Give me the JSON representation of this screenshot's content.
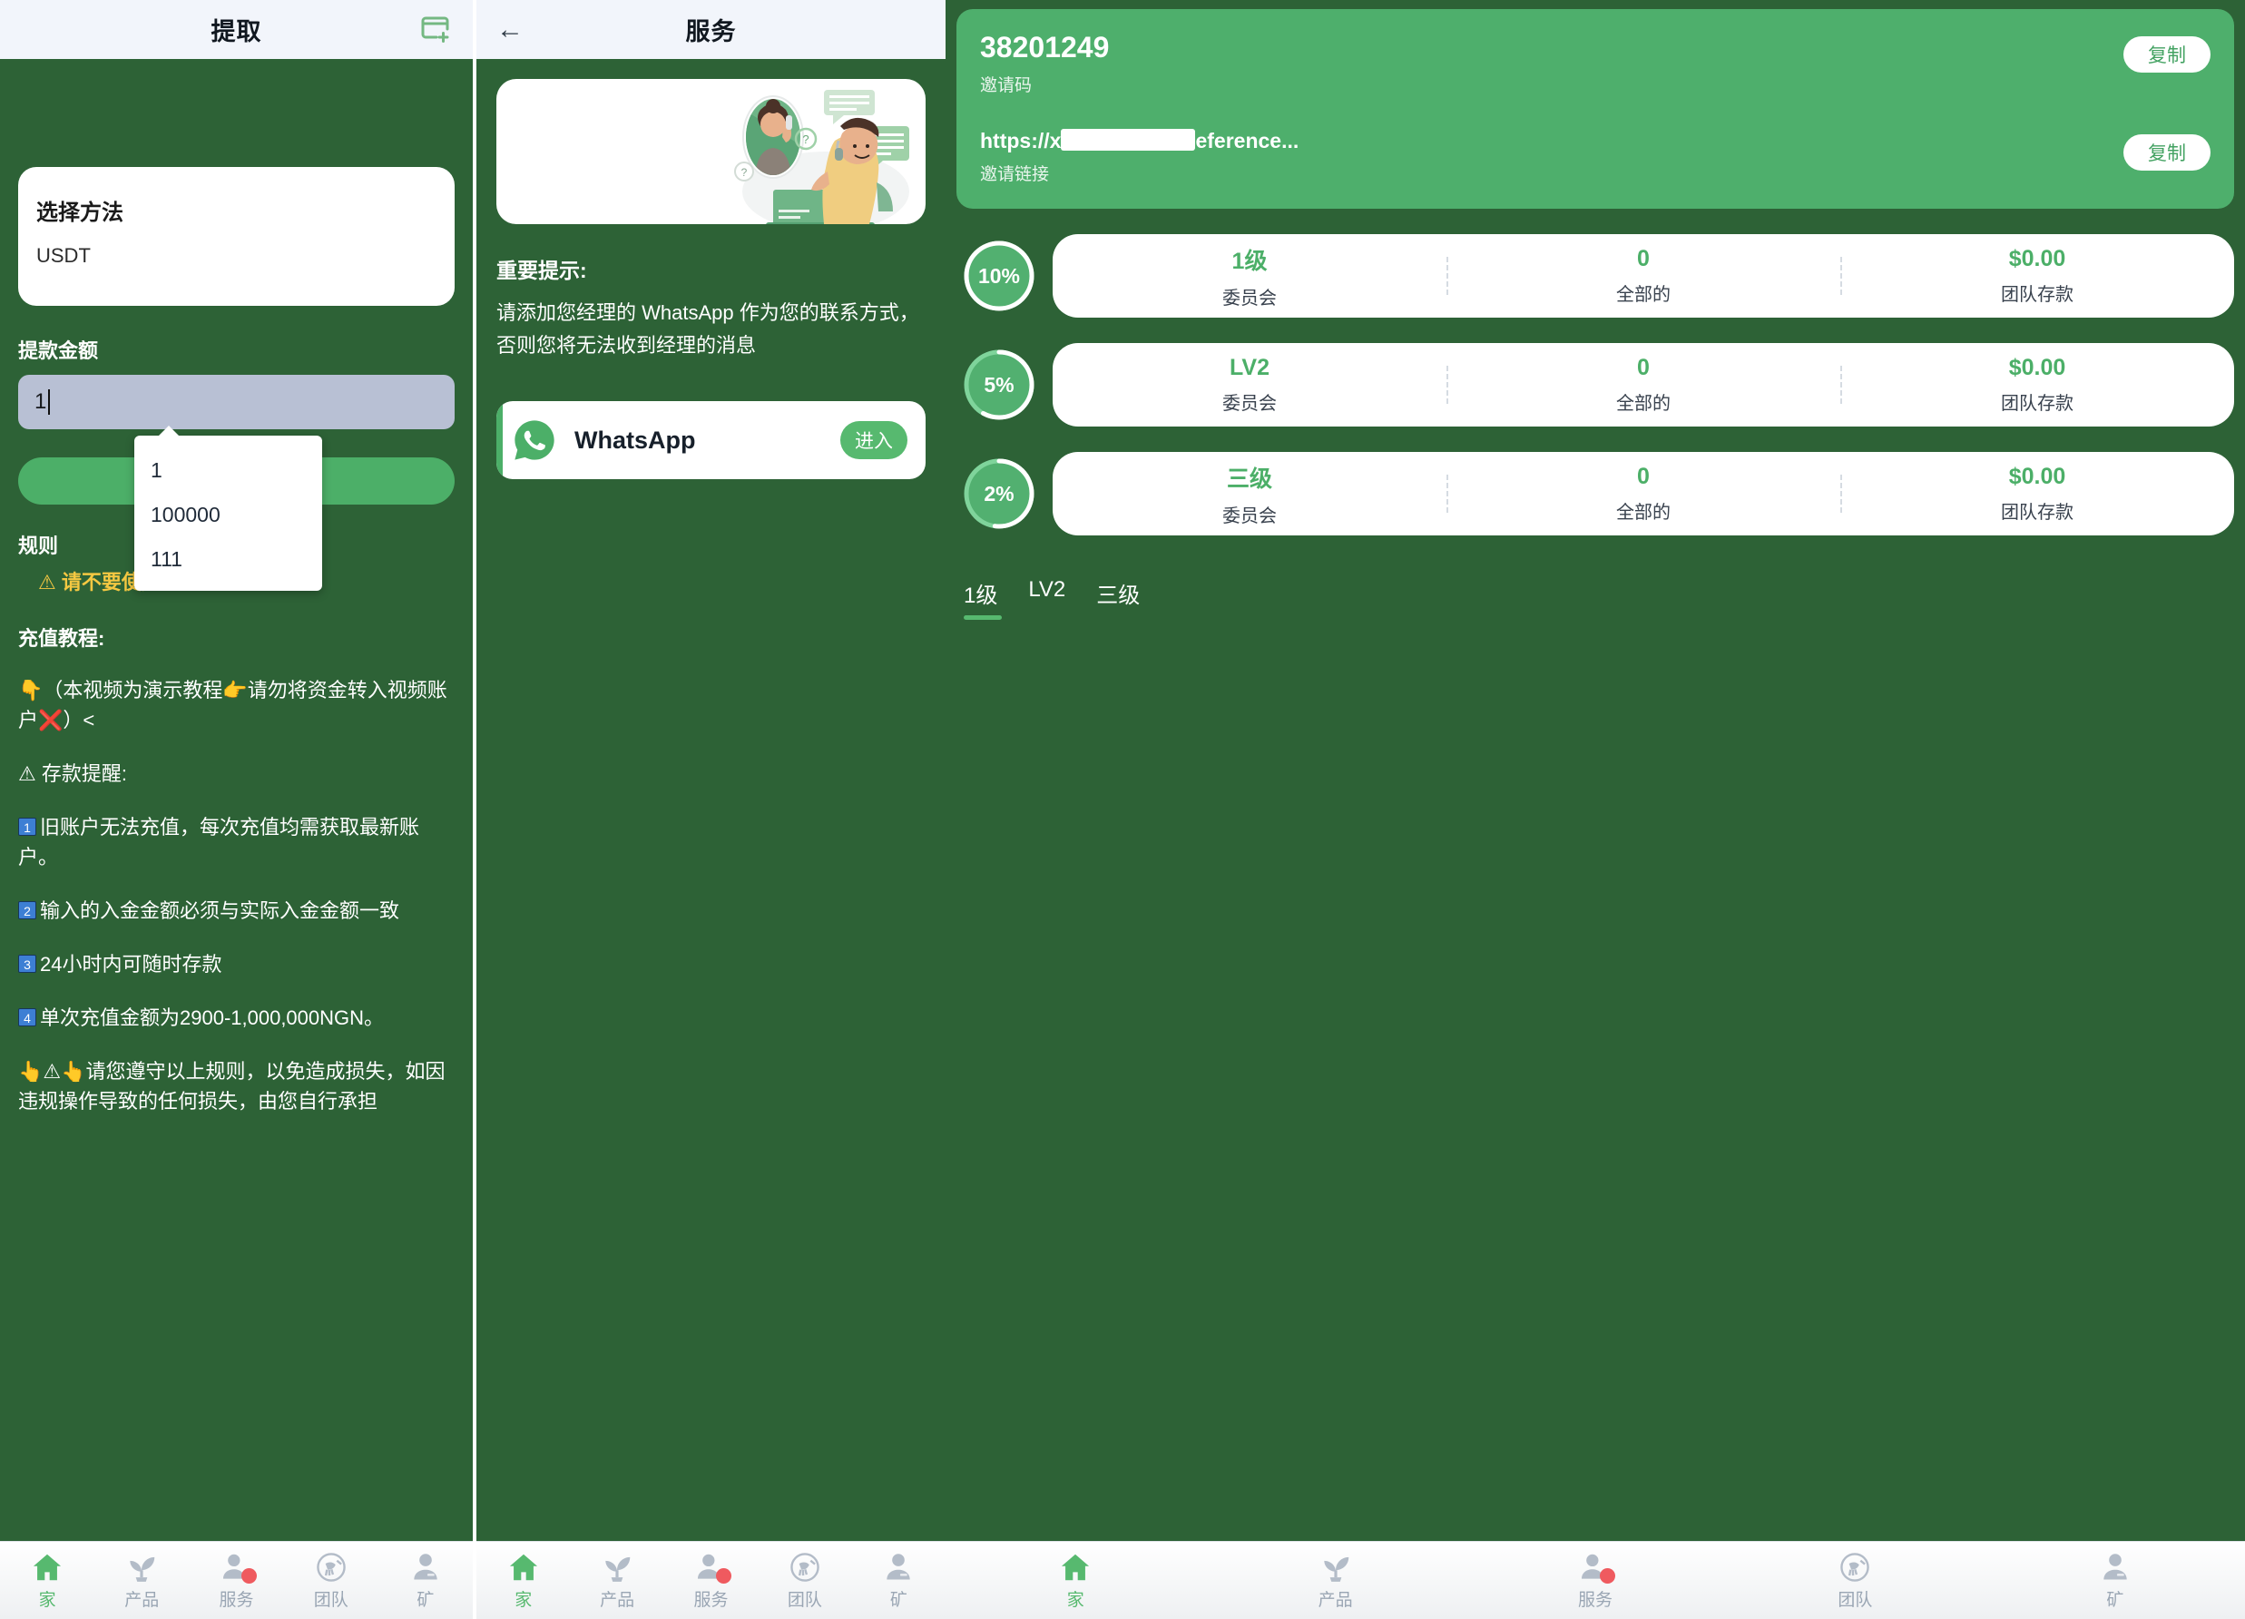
{
  "withdraw": {
    "title": "提取",
    "header_icon": "add-card-icon",
    "method": {
      "label": "选择方法",
      "value": "USDT"
    },
    "amount": {
      "label": "提款金额",
      "value": "1",
      "placeholder": ""
    },
    "submit_label": "",
    "autocomplete_options": [
      "1",
      "100000",
      "111"
    ],
    "rules": {
      "title": "规则",
      "warning": "⚠ 请不要使用",
      "tutorial_title": "充值教程:",
      "tutorial_text": "👇（本视频为演示教程👉请勿将资金转入视频账户❌）<",
      "deposit_reminder": "⚠ 存款提醒:",
      "items": [
        {
          "n": "1",
          "text": "旧账户无法充值，每次充值均需获取最新账户。"
        },
        {
          "n": "2",
          "text": "输入的入金金额必须与实际入金金额一致"
        },
        {
          "n": "3",
          "text": "24小时内可随时存款"
        },
        {
          "n": "4",
          "text": "单次充值金额为2900-1,000,000NGN。"
        }
      ],
      "footer": "👆⚠👆请您遵守以上规则，以免造成损失，如因违规操作导致的任何损失，由您自行承担"
    }
  },
  "service": {
    "title": "服务",
    "back_icon": "back-arrow-icon",
    "hero_art": "customer-support-illustration",
    "notice_title": "重要提示:",
    "notice_body": "请添加您经理的 WhatsApp 作为您的联系方式，否则您将无法收到经理的消息",
    "whatsapp": {
      "name": "WhatsApp",
      "icon": "whatsapp-icon",
      "enter_label": "进入"
    }
  },
  "team": {
    "invite": {
      "code": "38201249",
      "code_label": "邀请码",
      "copy_label": "复制",
      "link_prefix": "https://x",
      "link_suffix": "eference...",
      "link_label": "邀请链接",
      "link_copy_label": "复制"
    },
    "levels": [
      {
        "percent": "10%",
        "progress": 100,
        "name": "1级",
        "count": "0",
        "deposit": "$0.00",
        "name_key": "委员会",
        "count_key": "全部的",
        "deposit_key": "团队存款"
      },
      {
        "percent": "5%",
        "progress": 58,
        "name": "LV2",
        "count": "0",
        "deposit": "$0.00",
        "name_key": "委员会",
        "count_key": "全部的",
        "deposit_key": "团队存款"
      },
      {
        "percent": "2%",
        "progress": 52,
        "name": "三级",
        "count": "0",
        "deposit": "$0.00",
        "name_key": "委员会",
        "count_key": "全部的",
        "deposit_key": "团队存款"
      }
    ],
    "tabs": [
      "1级",
      "LV2",
      "三级"
    ],
    "active_tab": 0
  },
  "bottom_nav": {
    "items": [
      {
        "label": "家",
        "icon": "home-icon",
        "active": true,
        "badge": false
      },
      {
        "label": "产品",
        "icon": "plant-icon",
        "active": false,
        "badge": false
      },
      {
        "label": "服务",
        "icon": "person-icon",
        "active": false,
        "badge": true
      },
      {
        "label": "团队",
        "icon": "bird-icon",
        "active": false,
        "badge": false
      },
      {
        "label": "矿",
        "icon": "miner-icon",
        "active": false,
        "badge": false
      }
    ]
  },
  "colors": {
    "bg_green": "#2d6236",
    "accent_green": "#4caf68",
    "warn_yellow": "#f5c842",
    "input_gray": "#b8c0d4"
  }
}
